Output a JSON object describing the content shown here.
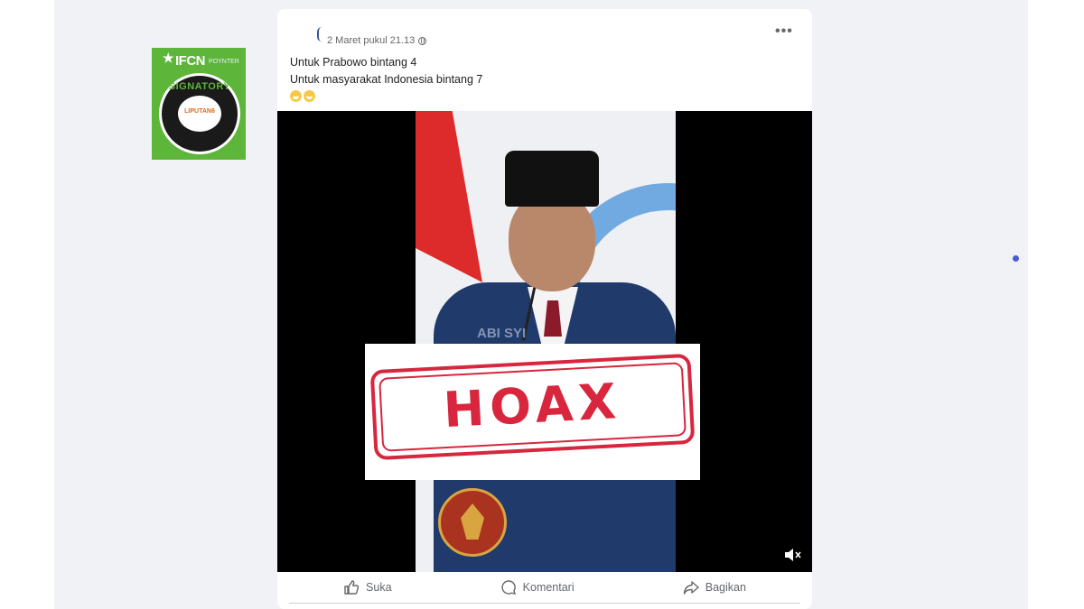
{
  "post": {
    "timestamp": "2 Maret pukul 21.13",
    "caption_line1": "Untuk Prabowo bintang 4",
    "caption_line2": "Untuk masyarakat Indonesia bintang 7",
    "more_label": "•••",
    "privacy_icon": "globe-icon"
  },
  "video": {
    "stamp_text": "HOAX",
    "watermark": "ABI    SYI",
    "muted": true
  },
  "badge": {
    "org": "IFCN",
    "sub": "POYNTER",
    "ring_label": "SIGNATORY",
    "center_logo": "LIPUTAN6"
  },
  "actions": [
    {
      "label": "Suka",
      "icon": "like-icon"
    },
    {
      "label": "Komentari",
      "icon": "comment-icon"
    },
    {
      "label": "Bagikan",
      "icon": "share-icon"
    }
  ],
  "colors": {
    "stamp_red": "#d7263d",
    "badge_green": "#5db53a",
    "feed_bg": "#f0f2f5"
  }
}
